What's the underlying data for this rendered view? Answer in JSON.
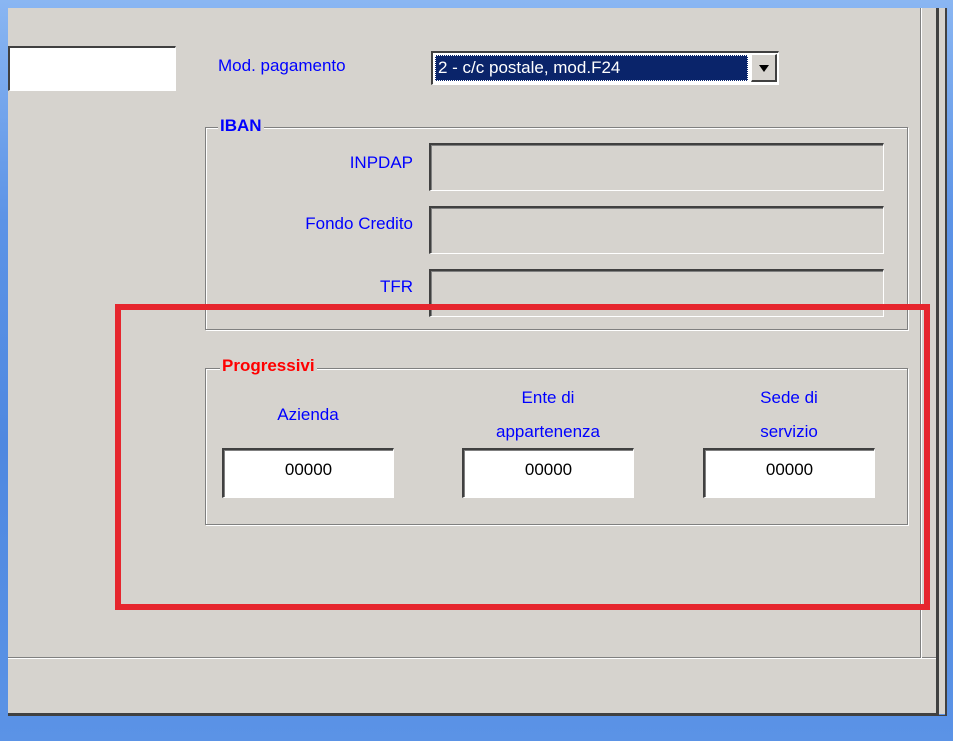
{
  "payment": {
    "label": "Mod. pagamento",
    "selected": "2 - c/c postale, mod.F24"
  },
  "iban": {
    "title": "IBAN",
    "fields": [
      {
        "label": "INPDAP",
        "value": ""
      },
      {
        "label": "Fondo Credito",
        "value": ""
      },
      {
        "label": "TFR",
        "value": ""
      }
    ]
  },
  "progressivi": {
    "title": "Progressivi",
    "columns": [
      {
        "label_line1": "Azienda",
        "label_line2": "",
        "value": "00000"
      },
      {
        "label_line1": "Ente di",
        "label_line2": "appartenenza",
        "value": "00000"
      },
      {
        "label_line1": "Sede di",
        "label_line2": "servizio",
        "value": "00000"
      }
    ]
  },
  "colors": {
    "label": "#0000ff",
    "progressivi_title": "#ff0000",
    "iban_title": "#0000ff",
    "highlight": "#e6262e",
    "selection": "#0a246a"
  }
}
